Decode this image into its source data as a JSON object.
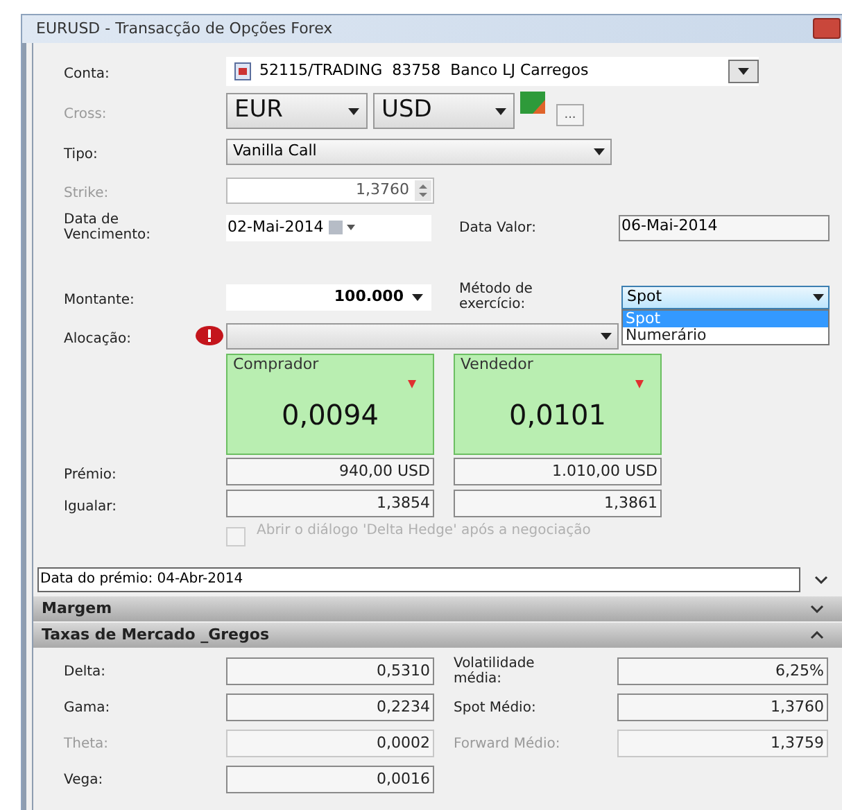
{
  "window": {
    "title": "EURUSD - Transacção de Opções Forex"
  },
  "account": {
    "label": "Conta:",
    "value": "52115/TRADING  83758  Banco LJ Carregos"
  },
  "cross": {
    "label": "Cross:",
    "base": "EUR",
    "quote": "USD",
    "more": "..."
  },
  "type": {
    "label": "Tipo:",
    "value": "Vanilla Call"
  },
  "strike": {
    "label": "Strike:",
    "value": "1,3760"
  },
  "expiry": {
    "label": "Data de Vencimento:",
    "value": "02-Mai-2014"
  },
  "value_date": {
    "label": "Data Valor:",
    "value": "06-Mai-2014"
  },
  "amount": {
    "label": "Montante:",
    "value": "100.000"
  },
  "exercise_method": {
    "label": "Método de exercício:",
    "value": "Spot",
    "options": [
      {
        "label": "Spot",
        "selected": true
      },
      {
        "label": "Numerário",
        "selected": false
      }
    ]
  },
  "allocation": {
    "label": "Alocação:"
  },
  "quotes": [
    {
      "label": "Comprador",
      "price": "0,0094"
    },
    {
      "label": "Vendedor",
      "price": "0,0101"
    }
  ],
  "premium": {
    "label": "Prémio:",
    "values": [
      "940,00 USD",
      "1.010,00 USD"
    ]
  },
  "equal": {
    "label": "Igualar:",
    "values": [
      "1,3854",
      "1,3861"
    ]
  },
  "delta_hedge": {
    "label": "Abrir o diálogo 'Delta Hedge' após a negociação",
    "checked": false,
    "disabled": true
  },
  "premium_date": "Data do prémio: 04-Abr-2014",
  "sections": [
    {
      "title": "Margem",
      "expanded": false
    },
    {
      "title": "Taxas de Mercado _Gregos",
      "expanded": true
    }
  ],
  "greeks": [
    [
      {
        "label": "Delta:",
        "value": "0,5310",
        "disabled": false
      },
      {
        "label": "Volatilidade média:",
        "value": "6,25%",
        "disabled": false
      }
    ],
    [
      {
        "label": "Gama:",
        "value": "0,2234",
        "disabled": false
      },
      {
        "label": "Spot Médio:",
        "value": "1,3760",
        "disabled": false
      }
    ],
    [
      {
        "label": "Theta:",
        "value": "0,0002",
        "disabled": true
      },
      {
        "label": "Forward Médio:",
        "value": "1,3759",
        "disabled": true
      }
    ],
    [
      {
        "label": "Vega:",
        "value": "0,0016",
        "disabled": false
      }
    ]
  ]
}
